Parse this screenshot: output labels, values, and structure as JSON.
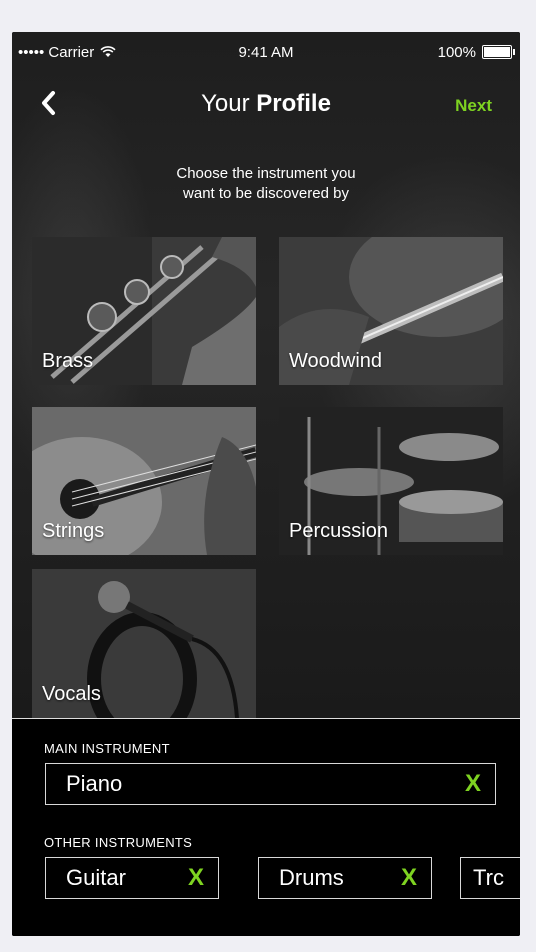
{
  "status_bar": {
    "carrier": "••••• Carrier",
    "time": "9:41 AM",
    "battery": "100%"
  },
  "nav": {
    "title_light": "Your ",
    "title_bold": "Profile",
    "next_label": "Next"
  },
  "subtitle": {
    "line1": "Choose the instrument you",
    "line2": "want to be discovered by"
  },
  "categories": [
    {
      "label": "Brass"
    },
    {
      "label": "Woodwind"
    },
    {
      "label": "Strings"
    },
    {
      "label": "Percussion"
    },
    {
      "label": "Vocals"
    }
  ],
  "main_instrument": {
    "section_label": "MAIN INSTRUMENT",
    "value": "Piano",
    "remove_label": "X"
  },
  "other_instruments": {
    "section_label": "OTHER INSTRUMENTS",
    "items": [
      {
        "label": "Guitar",
        "remove_label": "X"
      },
      {
        "label": "Drums",
        "remove_label": "X"
      },
      {
        "label": "Trc"
      }
    ]
  },
  "colors": {
    "accent": "#7ed321",
    "background": "#000000",
    "outer": "#efeff4"
  }
}
